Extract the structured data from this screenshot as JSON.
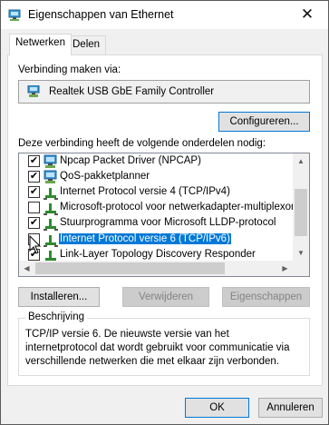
{
  "window": {
    "title": "Eigenschappen van Ethernet",
    "close_glyph": "✕",
    "icon": "network-adapter-icon"
  },
  "tabs": [
    {
      "label": "Netwerken",
      "active": true
    },
    {
      "label": "Delen",
      "active": false
    }
  ],
  "connect_via": {
    "label": "Verbinding maken via:",
    "adapter_name": "Realtek USB GbE Family Controller",
    "adapter_icon": "network-adapter-icon"
  },
  "configure_button": "Configureren...",
  "components": {
    "label": "Deze verbinding heeft de volgende onderdelen nodig:",
    "items": [
      {
        "label": "Npcap Packet Driver (NPCAP)",
        "checked": true,
        "icon": "network-adapter-icon",
        "selected": false
      },
      {
        "label": "QoS-pakketplanner",
        "checked": true,
        "icon": "network-adapter-icon",
        "selected": false
      },
      {
        "label": "Internet Protocol versie 4 (TCP/IPv4)",
        "checked": true,
        "icon": "protocol-icon",
        "selected": false
      },
      {
        "label": "Microsoft-protocol voor netwerkadapter-multiplexor",
        "checked": false,
        "icon": "protocol-icon",
        "selected": false
      },
      {
        "label": "Stuurprogramma voor Microsoft LLDP-protocol",
        "checked": true,
        "icon": "protocol-icon",
        "selected": false
      },
      {
        "label": "Internet Protocol versie 6 (TCP/IPv6)",
        "checked": false,
        "icon": "protocol-icon",
        "selected": true
      },
      {
        "label": "Link-Layer Topology Discovery Responder",
        "checked": true,
        "icon": "protocol-icon",
        "selected": false
      }
    ]
  },
  "buttons": {
    "install": "Installeren...",
    "uninstall": "Verwijderen",
    "properties": "Eigenschappen",
    "ok": "OK",
    "cancel": "Annuleren"
  },
  "description": {
    "title": "Beschrijving",
    "text": "TCP/IP versie 6. De nieuwste versie van het internetprotocol dat wordt gebruikt voor communicatie via verschillende netwerken die met elkaar zijn verbonden."
  },
  "colors": {
    "selection": "#0078d7",
    "focus_border": "#0078d7",
    "dialog_bg": "#f0f0f0"
  }
}
